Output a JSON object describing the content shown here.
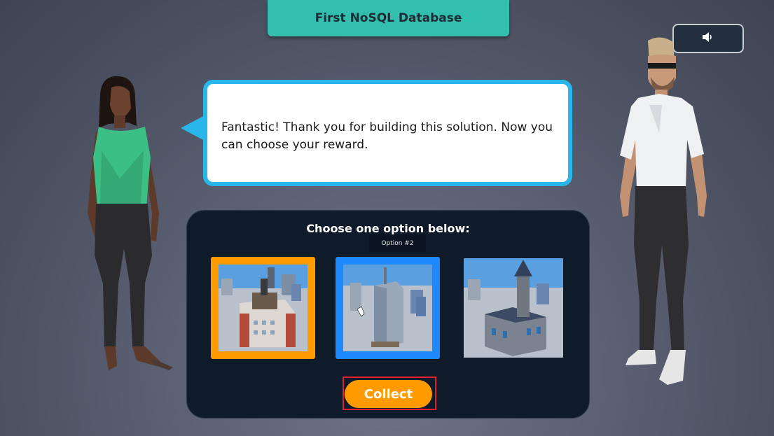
{
  "header": {
    "title": "First NoSQL Database"
  },
  "sound": {
    "icon": "speaker-icon"
  },
  "dialogue": {
    "text": "Fantastic! Thank you for building this solution. Now you can choose your reward."
  },
  "reward": {
    "heading": "Choose one option below:",
    "tooltip": "Option #2",
    "options": [
      {
        "id": "option-1",
        "selected": true,
        "border_color": "#ff9a00"
      },
      {
        "id": "option-2",
        "hovered": true,
        "border_color": "#1e88ff"
      },
      {
        "id": "option-3"
      }
    ],
    "collect_label": "Collect"
  },
  "colors": {
    "accent_teal": "#33bfae",
    "bubble_border": "#29b6e8",
    "panel_bg": "#0f1b2b",
    "collect_orange": "#ff9a00"
  }
}
